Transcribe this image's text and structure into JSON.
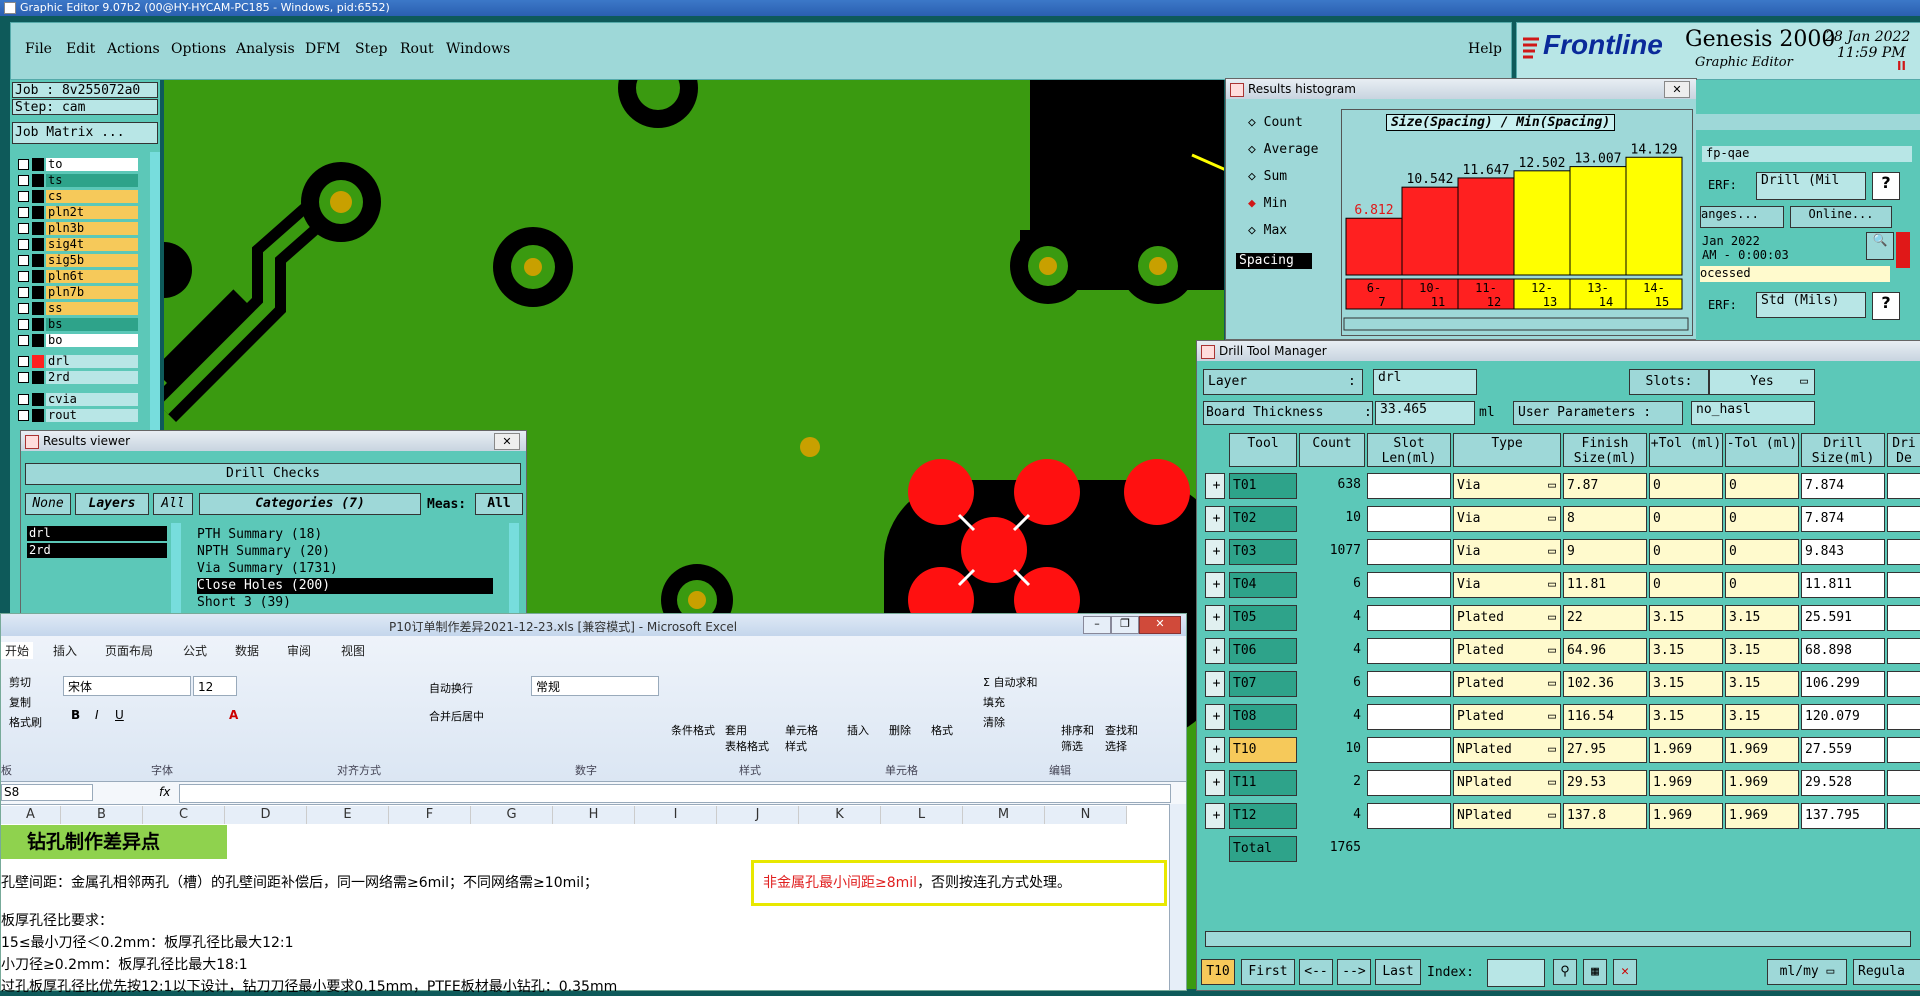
{
  "app": {
    "title": "Graphic Editor 9.07b2 (00@HY-HYCAM-PC185 - Windows, pid:6552)",
    "menu": [
      "File",
      "Edit",
      "Actions",
      "Options",
      "Analysis",
      "DFM",
      "Step",
      "Rout",
      "Windows"
    ],
    "help": "Help",
    "brand": "Frontline",
    "product": "Genesis 2000",
    "product_sub": "Graphic Editor",
    "date": "28 Jan 2022",
    "time": "11:59 PM",
    "pause": "II"
  },
  "left": {
    "job": "Job : 8v255072a0",
    "step": "Step: cam",
    "job_matrix": "Job Matrix ...",
    "layers": [
      {
        "name": "to",
        "color": "#ffffff"
      },
      {
        "name": "ts",
        "color": "#2ea38a"
      },
      {
        "name": "cs",
        "color": "#f6c95a"
      },
      {
        "name": "pln2t",
        "color": "#f6c95a"
      },
      {
        "name": "pln3b",
        "color": "#f6c95a"
      },
      {
        "name": "sig4t",
        "color": "#f6c95a"
      },
      {
        "name": "sig5b",
        "color": "#f6c95a"
      },
      {
        "name": "pln6t",
        "color": "#f6c95a"
      },
      {
        "name": "pln7b",
        "color": "#f6c95a"
      },
      {
        "name": "ss",
        "color": "#f6c95a"
      },
      {
        "name": "bs",
        "color": "#2ea38a"
      },
      {
        "name": "bo",
        "color": "#ffffff"
      }
    ],
    "layers2": [
      {
        "name": "drl",
        "color": "#b8e6e6"
      },
      {
        "name": "2rd",
        "color": "#b8e6e6"
      }
    ],
    "layers3": [
      {
        "name": "cvia",
        "color": "#b8e6e6"
      },
      {
        "name": "rout",
        "color": "#b8e6e6"
      }
    ]
  },
  "histogram": {
    "title": "Results histogram",
    "options": [
      "Count",
      "Average",
      "Sum",
      "Min",
      "Max"
    ],
    "selected": "Min",
    "field": "Spacing",
    "chart_title": "Size(Spacing) / Min(Spacing)",
    "right_strip": {
      "name": "fp-qae",
      "erf_label": "ERF:",
      "erf_value": "Drill (Mil",
      "ranges": "anges...",
      "online": "Online...",
      "date": "Jan 2022",
      "time": "AM - 0:00:03",
      "status": "ocessed",
      "erf2": "Std (Mils)"
    },
    "chart_data": {
      "type": "bar",
      "categories": [
        "6-7",
        "10-11",
        "11-12",
        "12-13",
        "13-14",
        "14-15"
      ],
      "values": [
        6.812,
        10.542,
        11.647,
        12.502,
        13.007,
        14.129
      ],
      "colors": [
        "#ff2020",
        "#ff2020",
        "#ff2020",
        "#ffff00",
        "#ffff00",
        "#ffff00"
      ],
      "labels": [
        "6.812",
        "10.542",
        "11.647",
        "12.502",
        "13.007",
        "14.129"
      ],
      "ylim": [
        0,
        15
      ]
    }
  },
  "dtm": {
    "title": "Drill Tool Manager",
    "layer_label": "Layer",
    "layer_sep": ":",
    "layer_value": "drl",
    "slots_label": "Slots:",
    "slots_value": "Yes",
    "thickness_label": "Board Thickness",
    "thickness_sep": ":",
    "thickness_value": "33.465",
    "thickness_unit": "ml",
    "user_params_label": "User Parameters :",
    "user_params_value": "no_hasl",
    "columns": [
      "Tool",
      "Count",
      "Slot Len(ml)",
      "Type",
      "Finish Size(ml)",
      "+Tol (ml)",
      "-Tol (ml)",
      "Drill Size(ml)",
      "Dri De"
    ],
    "rows": [
      {
        "tool": "T01",
        "count": "638",
        "type": "Via",
        "finish": "7.87",
        "ptol": "0",
        "ntol": "0",
        "drill": "7.874"
      },
      {
        "tool": "T02",
        "count": "10",
        "type": "Via",
        "finish": "8",
        "ptol": "0",
        "ntol": "0",
        "drill": "7.874"
      },
      {
        "tool": "T03",
        "count": "1077",
        "type": "Via",
        "finish": "9",
        "ptol": "0",
        "ntol": "0",
        "drill": "9.843"
      },
      {
        "tool": "T04",
        "count": "6",
        "type": "Via",
        "finish": "11.81",
        "ptol": "0",
        "ntol": "0",
        "drill": "11.811"
      },
      {
        "tool": "T05",
        "count": "4",
        "type": "Plated",
        "finish": "22",
        "ptol": "3.15",
        "ntol": "3.15",
        "drill": "25.591"
      },
      {
        "tool": "T06",
        "count": "4",
        "type": "Plated",
        "finish": "64.96",
        "ptol": "3.15",
        "ntol": "3.15",
        "drill": "68.898"
      },
      {
        "tool": "T07",
        "count": "6",
        "type": "Plated",
        "finish": "102.36",
        "ptol": "3.15",
        "ntol": "3.15",
        "drill": "106.299"
      },
      {
        "tool": "T08",
        "count": "4",
        "type": "Plated",
        "finish": "116.54",
        "ptol": "3.15",
        "ntol": "3.15",
        "drill": "120.079"
      },
      {
        "tool": "T10",
        "count": "10",
        "type": "NPlated",
        "finish": "27.95",
        "ptol": "1.969",
        "ntol": "1.969",
        "drill": "27.559"
      },
      {
        "tool": "T11",
        "count": "2",
        "type": "NPlated",
        "finish": "29.53",
        "ptol": "1.969",
        "ntol": "1.969",
        "drill": "29.528"
      },
      {
        "tool": "T12",
        "count": "4",
        "type": "NPlated",
        "finish": "137.8",
        "ptol": "1.969",
        "ntol": "1.969",
        "drill": "137.795"
      }
    ],
    "total_label": "Total",
    "total_value": "1765",
    "footer": {
      "current": "T10",
      "first": "First",
      "prev": "<--",
      "next": "-->",
      "last": "Last",
      "index": "Index:",
      "units": "ml/my",
      "regular": "Regula"
    }
  },
  "results_viewer": {
    "title": "Results viewer",
    "header": "Drill Checks",
    "none": "None",
    "layers": "Layers",
    "all": "All",
    "categories": "Categories (7)",
    "meas": "Meas:",
    "meas_value": "All",
    "layer_list": [
      "drl",
      "2rd"
    ],
    "items": [
      "PTH Summary (18)",
      "NPTH Summary (20)",
      "Via Summary (1731)",
      "Close Holes (200)",
      "Short 3 (39)"
    ]
  },
  "excel": {
    "title": "P10订单制作差异2021-12-23.xls  [兼容模式] - Microsoft Excel",
    "tabs": [
      "开始",
      "插入",
      "页面布局",
      "公式",
      "数据",
      "审阅",
      "视图"
    ],
    "clipboard": [
      "剪切",
      "复制",
      "格式刷"
    ],
    "font_name": "宋体",
    "font_size": "12",
    "groups": [
      "板",
      "字体",
      "对齐方式",
      "数字",
      "样式",
      "单元格",
      "编辑"
    ],
    "align": [
      "自动换行",
      "合并后居中"
    ],
    "number_format": "常规",
    "styles": [
      "条件格式",
      "套用\n表格格式",
      "单元格\n样式"
    ],
    "cells_btns": [
      "插入",
      "删除",
      "格式"
    ],
    "edit_btns": [
      "自动求和",
      "填充",
      "清除",
      "排序和\n筛选",
      "查找和\n选择"
    ],
    "namebox": "S8",
    "fx": "fx",
    "columns": [
      "A",
      "B",
      "C",
      "D",
      "E",
      "F",
      "G",
      "H",
      "I",
      "J",
      "K",
      "L",
      "M",
      "N"
    ],
    "heading": "钻孔制作差异点",
    "line1_a": "孔壁间距：金属孔相邻两孔（槽）的孔壁间距补偿后，同一网络需≥6mil；不同网络需≥10mil；",
    "line1_red": "非金属孔最小间距≥8mil",
    "line1_b": "，否则按连孔方式处理。",
    "line2": "板厚孔径比要求：",
    "line3": "15≤最小刀径＜0.2mm：板厚孔径比最大12:1",
    "line4": "小刀径≥0.2mm：板厚孔径比最大18:1",
    "line5": "过孔板厚孔径比优先按12:1以下设计，钻刀刀径最小要求0.15mm，PTFE板材最小钻孔：0.35mm"
  }
}
